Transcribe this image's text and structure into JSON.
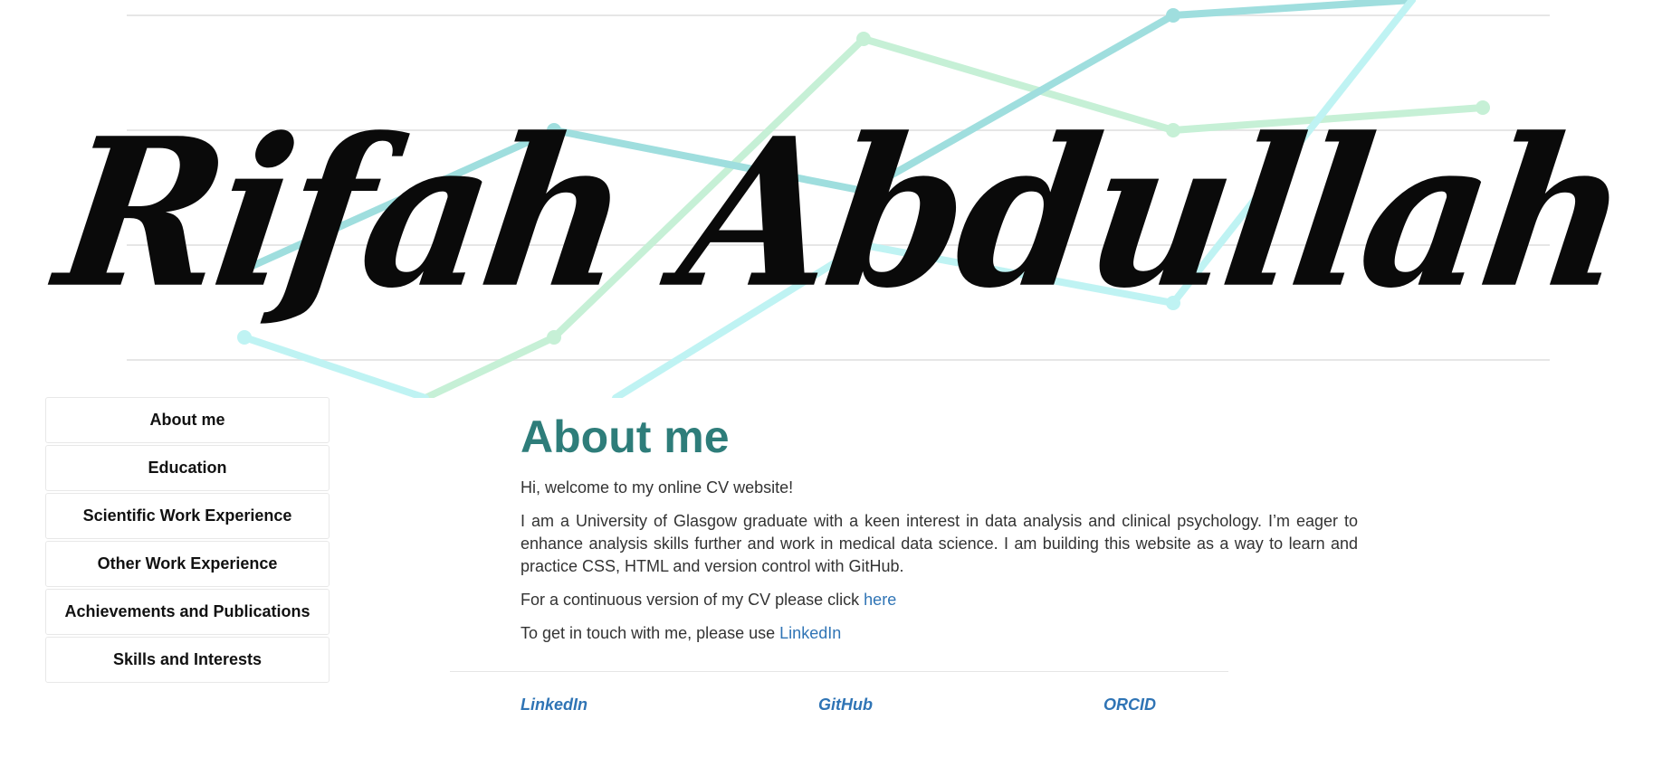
{
  "header": {
    "name_signature": "Rifah Abdullah"
  },
  "sidebar": {
    "items": [
      {
        "label": "About me"
      },
      {
        "label": "Education"
      },
      {
        "label": "Scientific Work Experience"
      },
      {
        "label": "Other Work Experience"
      },
      {
        "label": "Achievements and Publications"
      },
      {
        "label": "Skills and Interests"
      }
    ]
  },
  "main": {
    "title": "About me",
    "welcome": "Hi, welcome to my online CV website!",
    "intro": "I am a University of Glasgow graduate with a keen interest in data analysis and clinical psychology. I’m eager to enhance analysis skills further and work in medical data science. I am building this website as a way to learn and practice CSS, HTML and version control with GitHub.",
    "cv_prefix": "For a continuous version of my CV please click ",
    "cv_link": "here",
    "contact_prefix": "To get in touch with me, please use ",
    "contact_link": "LinkedIn"
  },
  "footer": {
    "links": [
      {
        "label": "LinkedIn"
      },
      {
        "label": "GitHub"
      },
      {
        "label": "ORCID"
      }
    ]
  },
  "colors": {
    "title_teal": "#2e7d7a",
    "link_blue": "#2f74b5",
    "line_teal": "#9fdede",
    "line_green": "#c6f0d6",
    "line_cyan": "#bff3f3",
    "gridline": "#e6e6e6"
  }
}
